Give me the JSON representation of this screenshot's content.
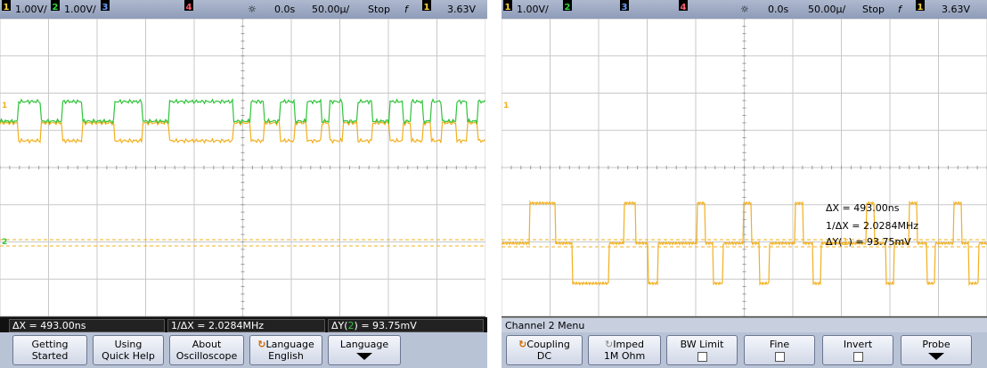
{
  "left": {
    "status": {
      "ch1_num": "1",
      "ch1_scale": "1.00V/",
      "ch2_num": "2",
      "ch2_scale": "1.00V/",
      "ch3_num": "3",
      "ch4_num": "4",
      "time_offset": "0.0s",
      "time_scale": "50.00µ/",
      "run_state": "Stop",
      "trig_symbol": "f",
      "trig_ch": "1",
      "trig_level": "3.63V"
    },
    "measurements": {
      "dx": "ΔX = 493.00ns",
      "inv_dx": "1/ΔX = 2.0284MHz",
      "dy_prefix": "ΔY(",
      "dy_ch": "2",
      "dy_suffix": ") = 93.75mV"
    },
    "softkeys": [
      {
        "line1": "Getting",
        "line2": "Started"
      },
      {
        "line1": "Using",
        "line2": "Quick Help"
      },
      {
        "line1": "About",
        "line2": "Oscilloscope"
      },
      {
        "line1": "Language",
        "line2": "English"
      },
      {
        "line1": "Language",
        "line2": ""
      }
    ],
    "markers": {
      "ch1": "1",
      "ch2": "2"
    }
  },
  "right": {
    "status": {
      "ch1_num": "1",
      "ch1_scale": "1.00V/",
      "ch2_num": "2",
      "ch3_num": "3",
      "ch4_num": "4",
      "time_offset": "0.0s",
      "time_scale": "50.00µ/",
      "run_state": "Stop",
      "trig_symbol": "f",
      "trig_ch": "1",
      "trig_level": "3.63V"
    },
    "menu_title": "Channel 2  Menu",
    "cursor_readout": {
      "dx": "ΔX = 493.00ns",
      "inv_dx": "1/ΔX = 2.0284MHz",
      "dy_prefix": "ΔY(",
      "dy_ch": "1",
      "dy_suffix": ") = 93.75mV"
    },
    "softkeys": [
      {
        "line1": "Coupling",
        "line2": "DC"
      },
      {
        "line1": "Imped",
        "line2": "1M Ohm"
      },
      {
        "line1": "BW Limit",
        "line2": ""
      },
      {
        "line1": "Fine",
        "line2": ""
      },
      {
        "line1": "Invert",
        "line2": ""
      },
      {
        "line1": "Probe",
        "line2": ""
      }
    ],
    "markers": {
      "ch1": "1"
    }
  },
  "colors": {
    "ch1": "#f2b01e",
    "ch2": "#2fc43a",
    "grid": "#c8c8c8",
    "cursor": "#f2b01e"
  }
}
